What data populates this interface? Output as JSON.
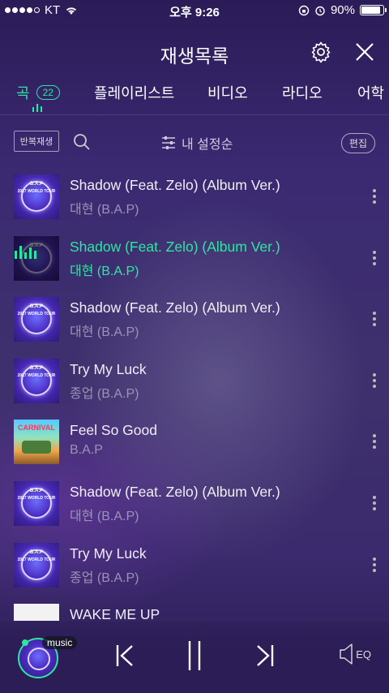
{
  "status": {
    "carrier": "KT",
    "time": "오후 9:26",
    "battery": "90%",
    "battery_level": 0.9
  },
  "header": {
    "title": "재생목록"
  },
  "tabs": [
    {
      "label": "곡",
      "count": "22"
    },
    {
      "label": "플레이리스트"
    },
    {
      "label": "비디오"
    },
    {
      "label": "라디오"
    },
    {
      "label": "어학"
    }
  ],
  "toolbar": {
    "repeat_label": "반복재생",
    "sort_label": "내 설정순",
    "edit_label": "편집"
  },
  "songs": [
    {
      "title": "Shadow (Feat. Zelo) (Album Ver.)",
      "artist": "대현 (B.A.P)"
    },
    {
      "title": "Shadow (Feat. Zelo) (Album Ver.)",
      "artist": "대현 (B.A.P)"
    },
    {
      "title": "Shadow (Feat. Zelo) (Album Ver.)",
      "artist": "대현 (B.A.P)"
    },
    {
      "title": "Try My Luck",
      "artist": "종업 (B.A.P)"
    },
    {
      "title": "Feel So Good",
      "artist": "B.A.P"
    },
    {
      "title": "Shadow (Feat. Zelo) (Album Ver.)",
      "artist": "대현 (B.A.P)"
    },
    {
      "title": "Try My Luck",
      "artist": "종업 (B.A.P)"
    },
    {
      "title": "WAKE ME UP",
      "artist": ""
    }
  ],
  "album_art_text": {
    "bap_brand": "B.A.P",
    "bap_tour": "2017 WORLD TOUR",
    "carnival_logo": "CARNIVAL"
  },
  "player": {
    "music_label": "music",
    "eq_label": "EQ"
  },
  "colors": {
    "accent": "#2ee6a0",
    "background": "#3b2a72"
  }
}
